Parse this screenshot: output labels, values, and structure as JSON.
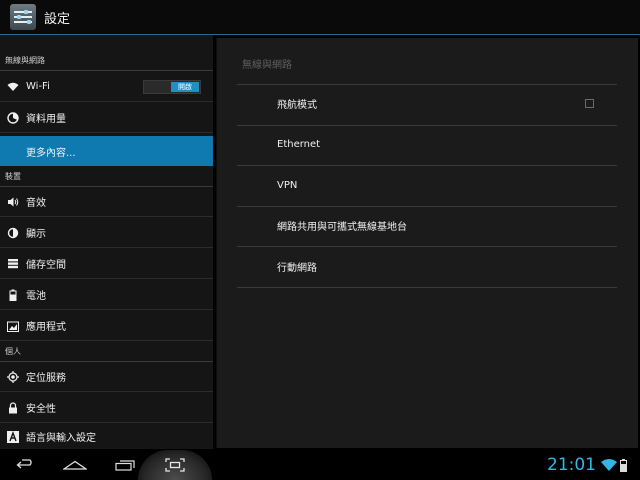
{
  "app": {
    "title": "設定",
    "icon": "settings-sliders-icon"
  },
  "sidebar": {
    "sections": [
      {
        "header": "無線與網路"
      },
      {
        "header": "裝置"
      },
      {
        "header": "個人"
      }
    ],
    "items": [
      {
        "label": "Wi-Fi",
        "icon": "wifi-icon",
        "toggle_label": "開啟"
      },
      {
        "label": "資料用量",
        "icon": "data-usage-icon"
      },
      {
        "label": "更多內容...",
        "selected": true
      },
      {
        "label": "音效",
        "icon": "speaker-icon"
      },
      {
        "label": "顯示",
        "icon": "brightness-icon"
      },
      {
        "label": "儲存空間",
        "icon": "storage-icon"
      },
      {
        "label": "電池",
        "icon": "battery-icon"
      },
      {
        "label": "應用程式",
        "icon": "apps-icon"
      },
      {
        "label": "定位服務",
        "icon": "location-icon"
      },
      {
        "label": "安全性",
        "icon": "lock-icon"
      },
      {
        "label": "語言與輸入設定",
        "icon": "language-icon"
      }
    ]
  },
  "main": {
    "title": "無線與網路",
    "items": [
      {
        "label": "飛航模式",
        "checkbox": false
      },
      {
        "label": "Ethernet"
      },
      {
        "label": "VPN"
      },
      {
        "label": "網路共用與可攜式無線基地台"
      },
      {
        "label": "行動網路"
      }
    ]
  },
  "navbar": {
    "buttons": [
      "back-icon",
      "home-icon",
      "recent-apps-icon",
      "screenshot-icon"
    ],
    "clock": "21:01"
  },
  "colors": {
    "accent": "#33b5e5",
    "selected": "#0f7ab0"
  }
}
